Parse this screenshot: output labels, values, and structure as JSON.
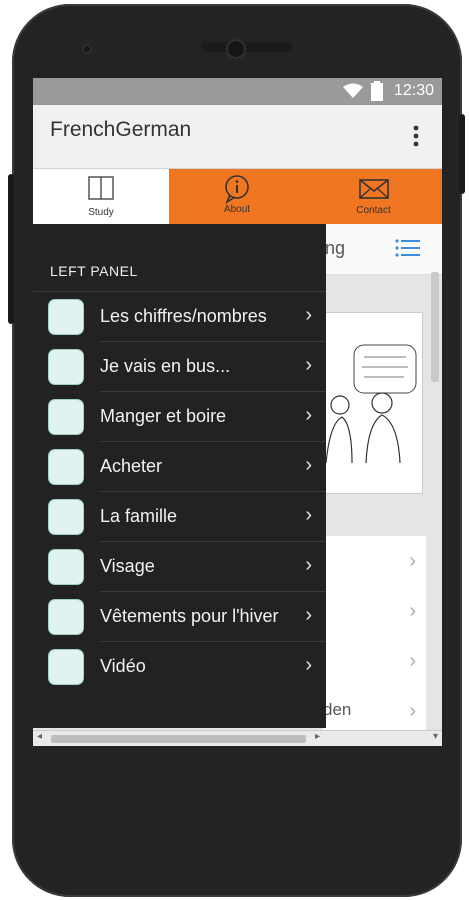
{
  "status_bar": {
    "time": "12:30"
  },
  "app_bar": {
    "title": "FrenchGerman"
  },
  "tabs": [
    {
      "label": "Study",
      "icon": "book-icon"
    },
    {
      "label": "About",
      "icon": "speech-info-icon"
    },
    {
      "label": "Contact",
      "icon": "envelope-icon"
    }
  ],
  "content": {
    "header_text": "ng",
    "list_rows": [
      {
        "text": ""
      },
      {
        "text": ""
      },
      {
        "text": ""
      },
      {
        "text": "den"
      }
    ]
  },
  "left_panel": {
    "title": "LEFT PANEL",
    "items": [
      {
        "label": "Les chiffres/nombres"
      },
      {
        "label": "Je vais en bus..."
      },
      {
        "label": "Manger et boire"
      },
      {
        "label": "Acheter"
      },
      {
        "label": "La famille"
      },
      {
        "label": "Visage"
      },
      {
        "label": "Vêtements pour l'hiver"
      },
      {
        "label": "Vidéo"
      }
    ]
  },
  "colors": {
    "accent": "#f07622",
    "panel_bg": "#222222",
    "status_bar": "#9a9a9a"
  }
}
